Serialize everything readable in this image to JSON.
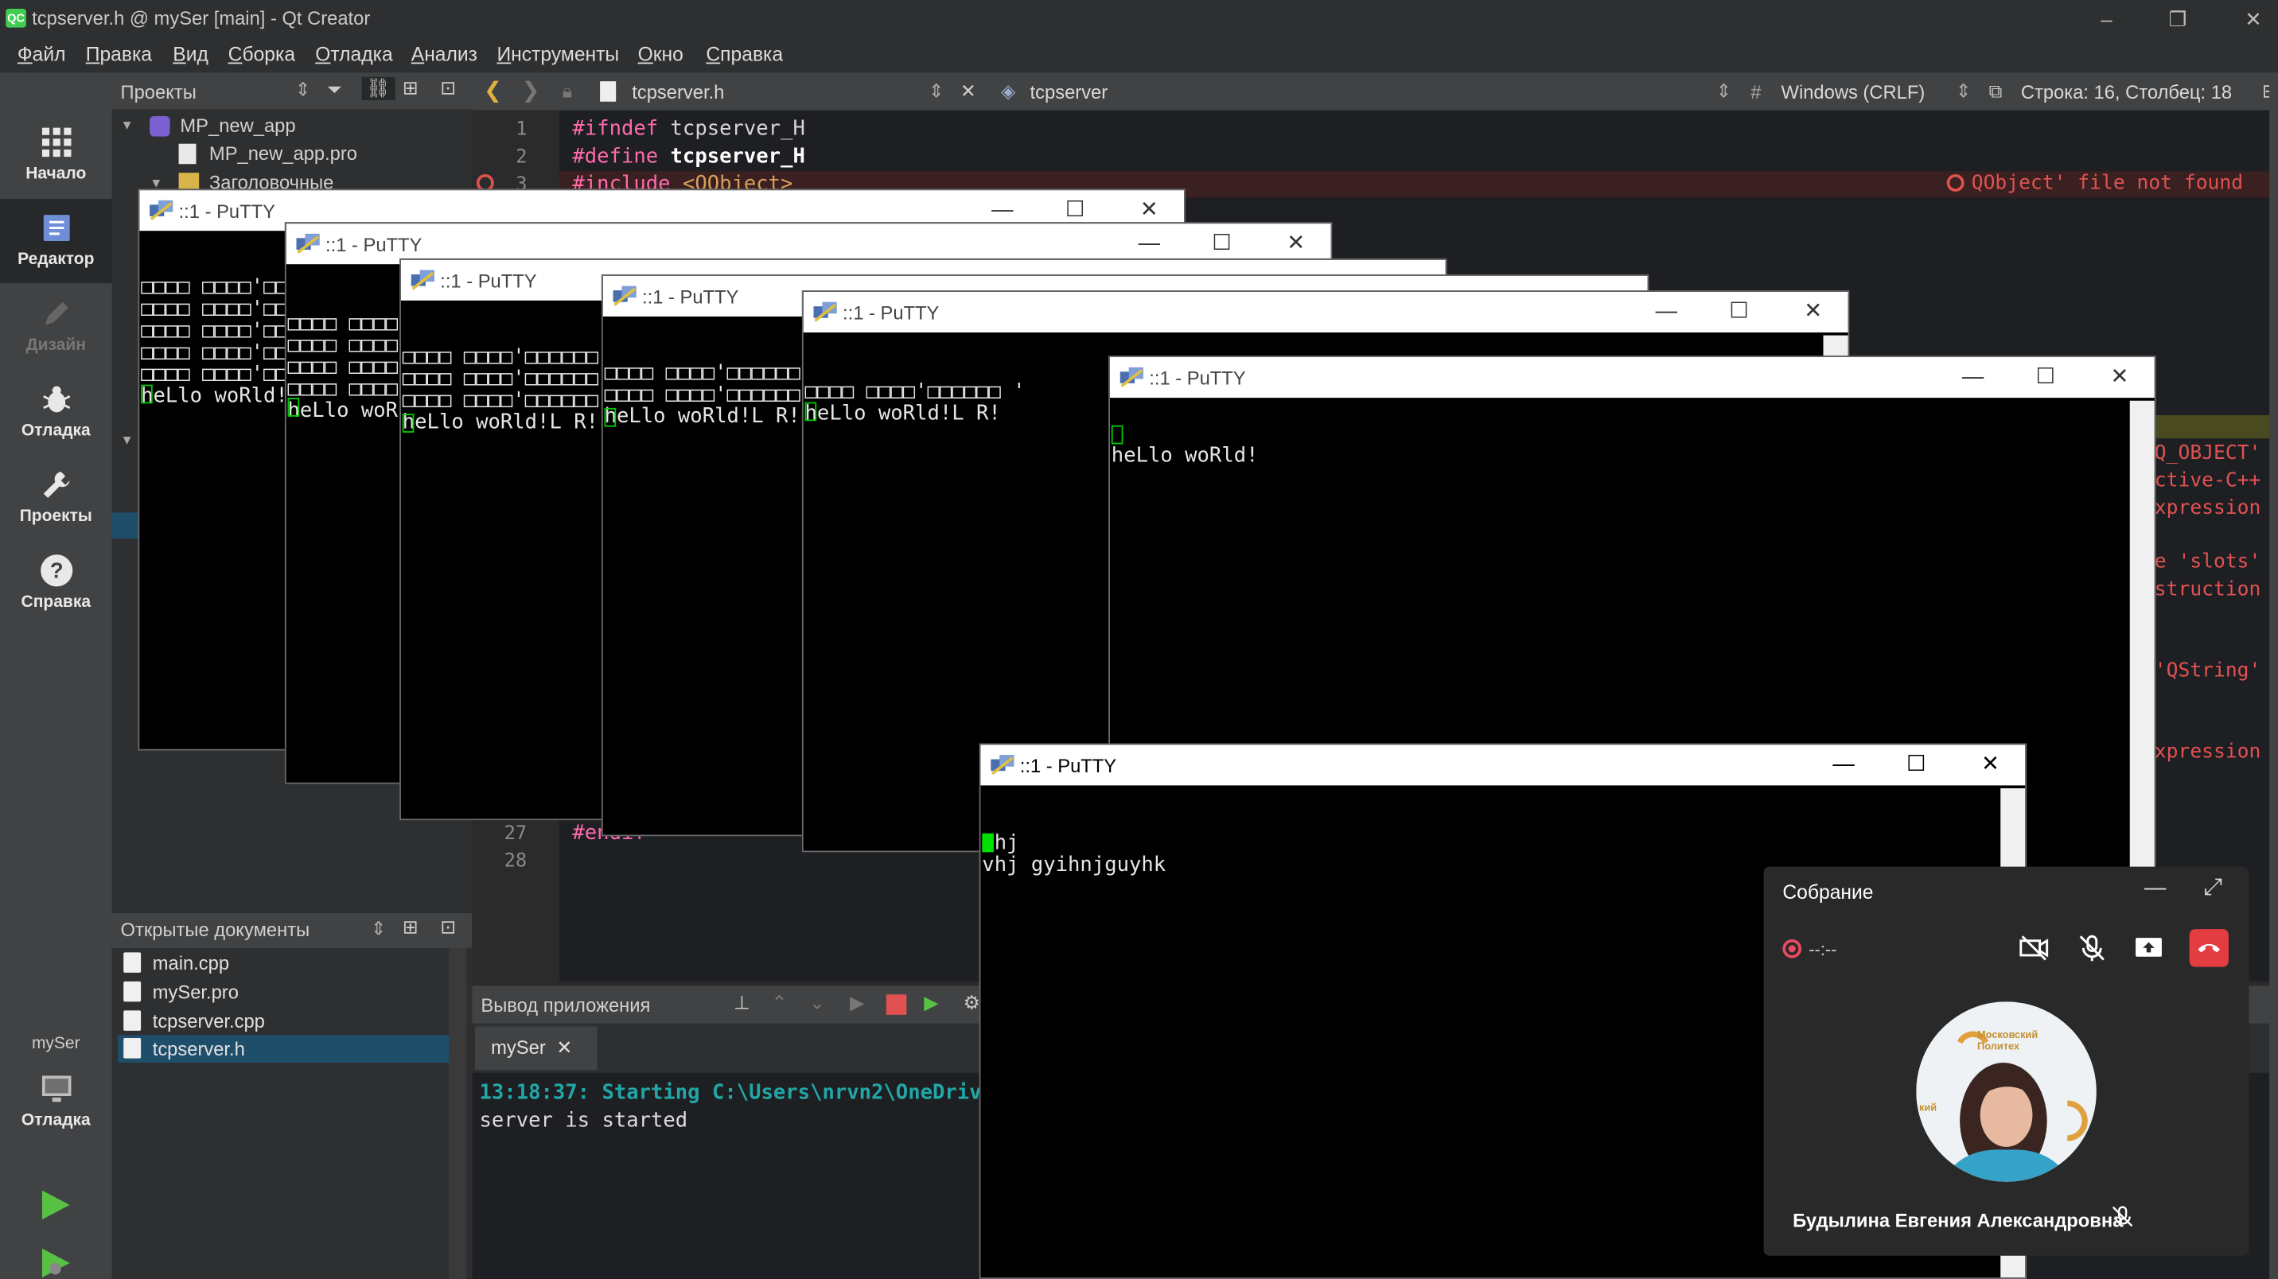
{
  "window": {
    "title": "tcpserver.h @ mySer [main] - Qt Creator",
    "app_icon": "qt-creator-icon",
    "logo_text": "QC"
  },
  "menu": [
    "Файл",
    "Правка",
    "Вид",
    "Сборка",
    "Отладка",
    "Анализ",
    "Инструменты",
    "Окно",
    "Справка"
  ],
  "modes": {
    "welcome": "Начало",
    "edit": "Редактор",
    "design": "Дизайн",
    "debug": "Отладка",
    "projects": "Проекты",
    "help": "Справка",
    "target_project": "mySer",
    "target_kind": "Отладка"
  },
  "projects_panel": {
    "header": "Проекты",
    "tree": [
      "MP_new_app",
      "MP_new_app.pro",
      "Заголовочные"
    ]
  },
  "open_documents": {
    "header": "Открытые документы",
    "items": [
      "main.cpp",
      "mySer.pro",
      "tcpserver.cpp",
      "tcpserver.h"
    ],
    "selected": "tcpserver.h"
  },
  "editor": {
    "file": "tcpserver.h",
    "symbol": "tcpserver",
    "line_ending_prefix": "#",
    "line_ending": "Windows (CRLF)",
    "cursor_pos": "Строка: 16, Столбец: 18",
    "lines": [
      {
        "num": "1",
        "prefix": "#ifndef",
        "rest": " tcpserver_H"
      },
      {
        "num": "2",
        "prefix": "#define",
        "rest": " tcpserver_H"
      },
      {
        "num": "3",
        "prefix": "#include",
        "rest": " <QObject>"
      },
      {
        "num": "27",
        "prefix": "#endif",
        "rest": ""
      },
      {
        "num": "28",
        "prefix": "",
        "rest": ""
      }
    ],
    "errors": [
      "QObject' file not found",
      "Q_OBJECT'",
      "ctive-C++",
      "xpression",
      "e 'slots'",
      "struction",
      "'QString'",
      "xpression"
    ]
  },
  "output": {
    "header": "Вывод приложения",
    "tab": "mySer",
    "lines": [
      "13:18:37: Starting C:\\Users\\nrvn2\\OneDrive",
      "server is started"
    ]
  },
  "putty_windows": [
    {
      "title": "::1 - PuTTY",
      "lines": [
        "□□□□ □□□□'□□□□□□",
        "□□□□ □□□□'□□□□□□",
        "□□□□ □□□□'□□□□□□",
        "□□□□ □□□□'□□□□□□",
        "□□□□ □□□□'□□□□□□",
        "heLlo woRld!L R!"
      ]
    },
    {
      "title": "::1 - PuTTY",
      "lines": [
        "□□□□ □□□□'□□□□□□",
        "□□□□ □□□□'□□□□□□",
        "□□□□ □□□□'□□□□□□",
        "□□□□ □□□□'□□□□□□",
        "heLlo woRld!L R!"
      ]
    },
    {
      "title": "::1 - PuTTY",
      "lines": [
        "□□□□ □□□□'□□□□□□",
        "□□□□ □□□□'□□□□□□",
        "□□□□ □□□□'□□□□□□",
        "heLlo woRld!L R!"
      ]
    },
    {
      "title": "::1 - PuTTY",
      "lines": [
        "□□□□ □□□□'□□□□□□",
        "□□□□ □□□□'□□□□□□",
        "heLlo woRld!L R!"
      ]
    },
    {
      "title": "::1 - PuTTY",
      "lines": [
        "□□□□ □□□□'□□□□□□ '",
        "heLlo woRld!L R!"
      ]
    },
    {
      "title": "::1 - PuTTY",
      "lines": [
        "heLlo woRld!"
      ]
    },
    {
      "title": "::1 - PuTTY",
      "lines": [
        "bhj",
        "vhj gyihnjguyhk"
      ]
    }
  ],
  "meeting": {
    "title": "Собрание",
    "timer": "--:--",
    "participant": "Будылина Евгения Александровна",
    "badge": "Московский Политех",
    "badge_fragment": "кий",
    "colors": {
      "hangup": "#e43d41",
      "recording": "#e84a5f"
    }
  },
  "icons": [
    "putty-icon",
    "grid-icon",
    "edit-icon",
    "bug-icon",
    "wrench-icon",
    "help-icon",
    "monitor-icon",
    "run-icon",
    "debug-run-icon"
  ]
}
